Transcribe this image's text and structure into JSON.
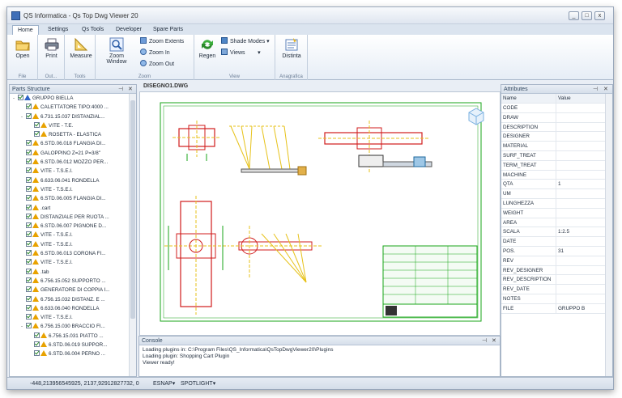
{
  "window": {
    "title": "QS Informatica - Qs Top Dwg Viewer 20",
    "minimize": "_",
    "maximize": "□",
    "close": "x"
  },
  "tabs": [
    "Home",
    "Settings",
    "Qs Tools",
    "Developer",
    "Spare Parts"
  ],
  "ribbon": {
    "open": "Open",
    "print": "Print",
    "measure": "Measure",
    "zoom_window": "Zoom Window",
    "zoom_extents": "Zoom Extents",
    "zoom_in": "Zoom In",
    "zoom_out": "Zoom Out",
    "regen": "Regen",
    "shade_modes": "Shade Modes",
    "views": "Views",
    "distinta": "Distinta",
    "groups": {
      "file": "File",
      "output": "Out...",
      "tools": "Tools",
      "zoom": "Zoom",
      "view": "View",
      "anagrafica": "Anagrafica"
    }
  },
  "parts_panel": {
    "title": "Parts Structure",
    "items": [
      {
        "label": "GRUPPO BIELLA",
        "level": 0,
        "icon": "blue",
        "expander": "-"
      },
      {
        "label": "CALETTATORE TIPO:4000 ...",
        "level": 1,
        "icon": "warn",
        "expander": ""
      },
      {
        "label": "6.731.15.037 DISTANZIAL...",
        "level": 1,
        "icon": "warn",
        "expander": "-"
      },
      {
        "label": "VITE - T.E.",
        "level": 2,
        "icon": "warn",
        "expander": ""
      },
      {
        "label": "ROSETTA - ELASTICA",
        "level": 2,
        "icon": "warn",
        "expander": ""
      },
      {
        "label": "6.STD.06.018 FLANGIA DI...",
        "level": 1,
        "icon": "warn",
        "expander": ""
      },
      {
        "label": "GALOPPINO Z=21 P=3/8\"",
        "level": 1,
        "icon": "warn",
        "expander": ""
      },
      {
        "label": "6.STD.06.012 MOZZO PER...",
        "level": 1,
        "icon": "warn",
        "expander": ""
      },
      {
        "label": "VITE - T.S.E.I.",
        "level": 1,
        "icon": "warn",
        "expander": ""
      },
      {
        "label": "6.633.06.041 RONDELLA",
        "level": 1,
        "icon": "warn",
        "expander": ""
      },
      {
        "label": "VITE - T.S.E.I.",
        "level": 1,
        "icon": "warn",
        "expander": ""
      },
      {
        "label": "6.STD.06.005 FLANGIA DI...",
        "level": 1,
        "icon": "warn",
        "expander": ""
      },
      {
        "label": ".cart",
        "level": 1,
        "icon": "warn",
        "expander": ""
      },
      {
        "label": "DISTANZIALE PER RUOTA ...",
        "level": 1,
        "icon": "warn",
        "expander": ""
      },
      {
        "label": "6.STD.06.007 PIGNONE D...",
        "level": 1,
        "icon": "warn",
        "expander": ""
      },
      {
        "label": "VITE - T.S.E.I.",
        "level": 1,
        "icon": "warn",
        "expander": ""
      },
      {
        "label": "VITE - T.S.E.I.",
        "level": 1,
        "icon": "warn",
        "expander": ""
      },
      {
        "label": "6.STD.06.013 CORONA FI...",
        "level": 1,
        "icon": "warn",
        "expander": ""
      },
      {
        "label": "VITE - T.S.E.I.",
        "level": 1,
        "icon": "warn",
        "expander": ""
      },
      {
        "label": ".tab",
        "level": 1,
        "icon": "warn",
        "expander": ""
      },
      {
        "label": "6.756.15.052 SUPPORTO ...",
        "level": 1,
        "icon": "warn",
        "expander": ""
      },
      {
        "label": "GENERATORE DI COPPIA I...",
        "level": 1,
        "icon": "warn",
        "expander": ""
      },
      {
        "label": "6.756.15.032 DISTANZ. E ...",
        "level": 1,
        "icon": "warn",
        "expander": ""
      },
      {
        "label": "6.633.06.040 RONDELLA",
        "level": 1,
        "icon": "warn",
        "expander": ""
      },
      {
        "label": "VITE - T.S.E.I.",
        "level": 1,
        "icon": "warn",
        "expander": ""
      },
      {
        "label": "6.756.15.030 BRACCIO FI...",
        "level": 1,
        "icon": "warn",
        "expander": "-"
      },
      {
        "label": "6.756.15.031 PIATTO ...",
        "level": 2,
        "icon": "warn",
        "expander": ""
      },
      {
        "label": "6.STD.06.019 SUPPOR...",
        "level": 2,
        "icon": "warn",
        "expander": ""
      },
      {
        "label": "6.STD.06.004 PERNO ...",
        "level": 2,
        "icon": "warn",
        "expander": ""
      }
    ]
  },
  "document": {
    "tab": "DISEGNO1.DWG"
  },
  "console": {
    "title": "Console",
    "lines": [
      "Loading plugins in: C:\\Program Files\\QS_Informatica\\QsTopDwgViewer20\\Plugins",
      "Loading plugin: Shopping Cart Plugin",
      "Viewer ready!"
    ]
  },
  "attributes": {
    "title": "Attributes",
    "header_name": "Name",
    "header_value": "Value",
    "rows": [
      {
        "name": "CODE",
        "value": ""
      },
      {
        "name": "DRAW",
        "value": ""
      },
      {
        "name": "DESCRIPTION",
        "value": ""
      },
      {
        "name": "DESIGNER",
        "value": ""
      },
      {
        "name": "MATERIAL",
        "value": ""
      },
      {
        "name": "SURF_TREAT",
        "value": ""
      },
      {
        "name": "TERM_TREAT",
        "value": ""
      },
      {
        "name": "MACHINE",
        "value": ""
      },
      {
        "name": "QTA",
        "value": "1"
      },
      {
        "name": "UM",
        "value": ""
      },
      {
        "name": "LUNGHEZZA",
        "value": ""
      },
      {
        "name": "WEIGHT",
        "value": ""
      },
      {
        "name": "AREA",
        "value": ""
      },
      {
        "name": "SCALA",
        "value": "1:2.5"
      },
      {
        "name": "DATE",
        "value": ""
      },
      {
        "name": "POS.",
        "value": "31"
      },
      {
        "name": "REV",
        "value": ""
      },
      {
        "name": "REV_DESIGNER",
        "value": ""
      },
      {
        "name": "REV_DESCRIPTION",
        "value": ""
      },
      {
        "name": "REV_DATE",
        "value": ""
      },
      {
        "name": "NOTES",
        "value": ""
      },
      {
        "name": "FILE",
        "value": "GRUPPO B"
      }
    ]
  },
  "statusbar": {
    "coords": "-448,213956545925, 2137,92912827732, 0",
    "esnap": "ESNAP",
    "spotlight": "SPOTLIGHT"
  },
  "colors": {
    "accent": "#3b6fb6",
    "drawing_green": "#19a519",
    "drawing_red": "#d01c1c",
    "drawing_yellow": "#e7c21a"
  }
}
